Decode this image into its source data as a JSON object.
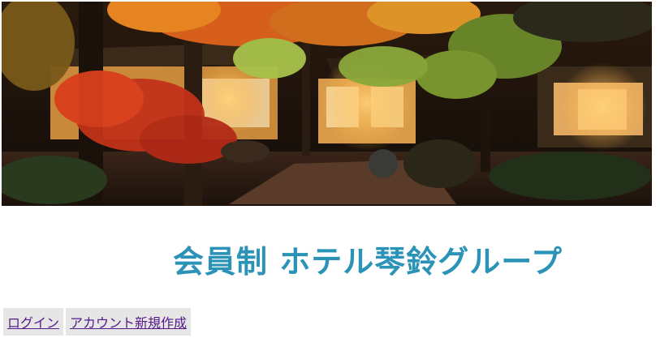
{
  "header": {
    "banner_image": "japanese-inn-autumn-garden-night-photo",
    "site_title": "会員制 ホテル琴鈴グループ"
  },
  "nav": {
    "items": [
      {
        "label": "ログイン"
      },
      {
        "label": "アカウント新規作成"
      }
    ]
  },
  "colors": {
    "title": "#2b93b7",
    "nav_link": "#551a8b",
    "nav_background": "#e6e6e6"
  }
}
